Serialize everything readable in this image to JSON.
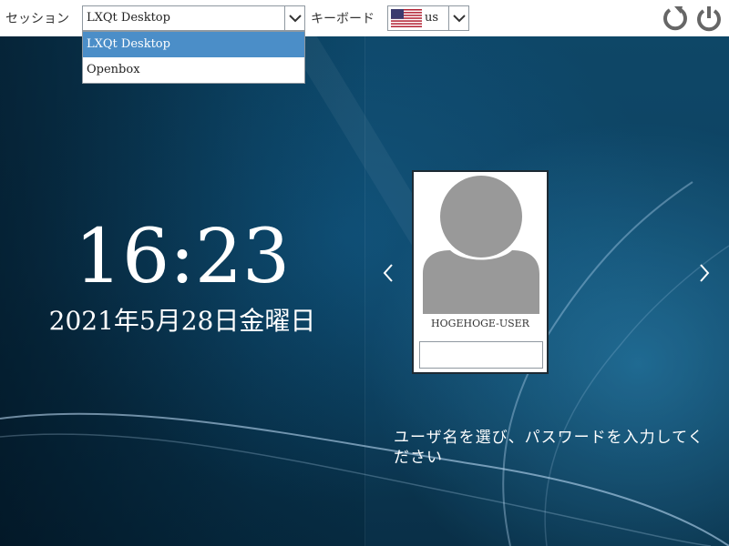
{
  "topbar": {
    "session_label": "セッション",
    "session_value": "LXQt Desktop",
    "keyboard_label": "キーボード",
    "keyboard_value": "us"
  },
  "session_options": [
    {
      "label": "LXQt Desktop",
      "selected": true
    },
    {
      "label": "Openbox",
      "selected": false
    }
  ],
  "clock": {
    "time": "16:23",
    "date": "2021年5月28日金曜日"
  },
  "user": {
    "name": "HOGEHOGE-USER",
    "password_value": ""
  },
  "prompt_text": "ユーザ名を選び、パスワードを入力してください",
  "icons": {
    "restart": "restart-icon",
    "shutdown": "power-icon",
    "flag": "us-flag-icon",
    "prev": "chevron-left-icon",
    "next": "chevron-right-icon"
  },
  "colors": {
    "selection": "#4b8ec8",
    "system_icons": "#666666",
    "background": "#0b3e5c"
  }
}
